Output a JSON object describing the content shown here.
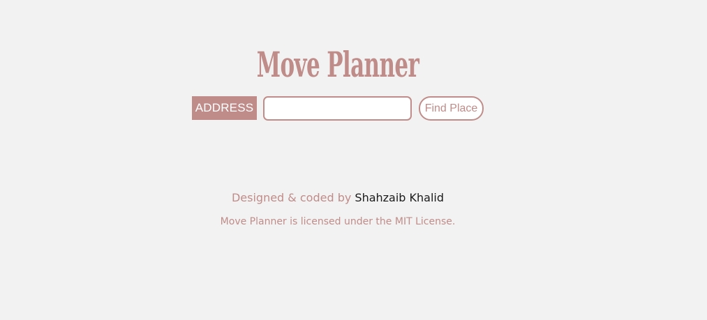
{
  "app": {
    "title": "Move Planner"
  },
  "search": {
    "label": "ADDRESS",
    "value": "",
    "placeholder": "",
    "button_label": "Find Place"
  },
  "footer": {
    "credit_prefix": "Designed & coded by",
    "author_name": "Shahzaib Khalid",
    "license_text": "Move Planner is licensed under the MIT License."
  },
  "colors": {
    "accent": "#bf8c89",
    "background": "#f2f2f2",
    "author_link": "#1a1a1a"
  }
}
